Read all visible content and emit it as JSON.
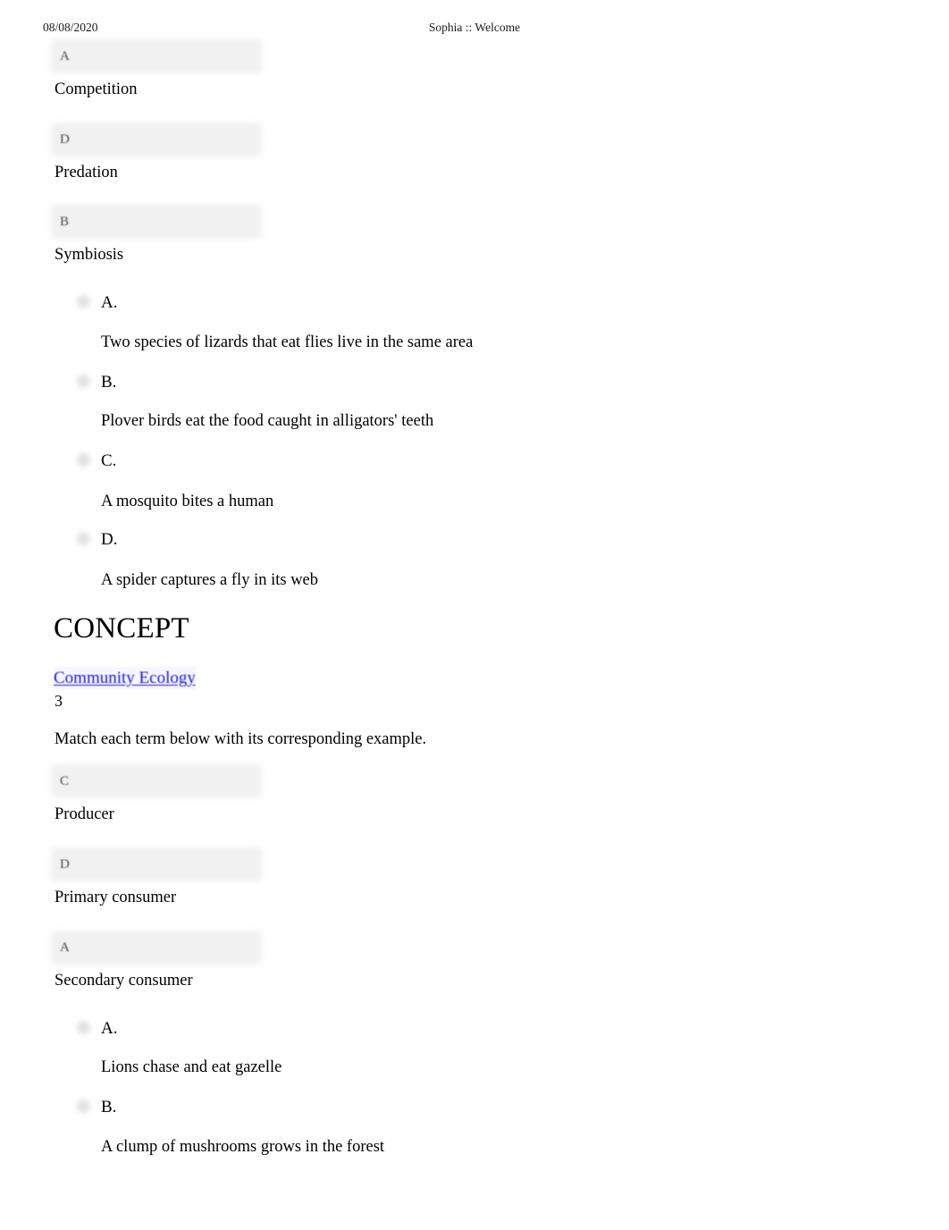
{
  "print_header": {
    "date": "08/08/2020",
    "title": "Sophia :: Welcome"
  },
  "question_1": {
    "matches": [
      {
        "answer_value": "A",
        "term": "Competition"
      },
      {
        "answer_value": "D",
        "term": "Predation"
      },
      {
        "answer_value": "B",
        "term": "Symbiosis"
      }
    ],
    "choices": [
      {
        "letter": "A.",
        "text": "Two species of lizards that eat flies live in the same area"
      },
      {
        "letter": "B.",
        "text": "Plover birds eat the food caught in alligators' teeth"
      },
      {
        "letter": "C.",
        "text": "A mosquito bites a human"
      },
      {
        "letter": "D.",
        "text": "A spider captures a fly in its web"
      }
    ]
  },
  "concept": {
    "heading": "CONCEPT",
    "link_label": "Community Ecology",
    "number": "3",
    "link_color": "#1919e6"
  },
  "question_2": {
    "instruction": "Match each term below with its corresponding example.",
    "matches": [
      {
        "answer_value": "C",
        "term": "Producer"
      },
      {
        "answer_value": "D",
        "term": "Primary consumer"
      },
      {
        "answer_value": "A",
        "term": "Secondary consumer"
      }
    ],
    "choices": [
      {
        "letter": "A.",
        "text": "Lions chase and eat gazelle"
      },
      {
        "letter": "B.",
        "text": "A clump of mushrooms grows in the forest"
      }
    ]
  }
}
